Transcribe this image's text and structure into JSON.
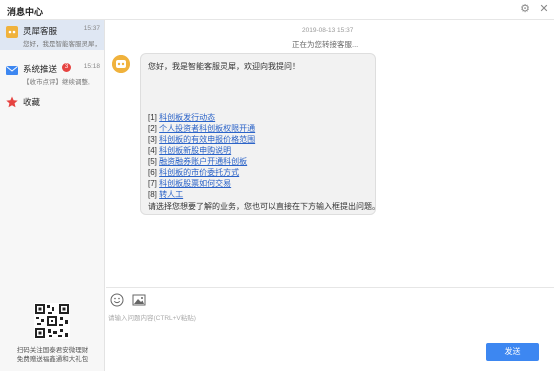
{
  "window": {
    "title": "消息中心",
    "settings_icon": "gear-icon",
    "close_icon": "close-icon"
  },
  "sidebar": {
    "items": [
      {
        "name": "灵犀客服",
        "time": "15:37",
        "preview": "您好，我是智能客服灵犀，欢迎向我提问！",
        "icon": "robot-icon"
      },
      {
        "name": "系统推送",
        "time": "15:18",
        "preview": "【收市点评】继续调整,",
        "badge": "3",
        "icon": "mail-icon"
      },
      {
        "name": "收藏",
        "icon": "star-icon"
      }
    ],
    "qr_text": "扫码关注国泰君安微理财\n免费赠送福鑫通和大礼包"
  },
  "chat": {
    "timestamp": "2019-08-13 15:37",
    "system_message": "正在为您转接客服...",
    "greeting": "您好，我是智能客服灵犀，欢迎向我提问！",
    "options": [
      {
        "num": "[1]",
        "label": "科创板发行动态"
      },
      {
        "num": "[2]",
        "label": "个人投资者科创板权限开通"
      },
      {
        "num": "[3]",
        "label": "科创板的有效申报价格范围"
      },
      {
        "num": "[4]",
        "label": "科创板新股申购说明"
      },
      {
        "num": "[5]",
        "label": "融资融券账户开通科创板"
      },
      {
        "num": "[6]",
        "label": "科创板的市价委托方式"
      },
      {
        "num": "[7]",
        "label": "科创板股票如何交易"
      },
      {
        "num": "[8]",
        "label": "转人工"
      }
    ],
    "prompt": "请选择您想要了解的业务，您也可以直接在下方输入框提出问题。"
  },
  "composer": {
    "placeholder": "请输入问题内容(CTRL+V粘贴)",
    "send_label": "发送",
    "emoji_icon": "emoji-icon",
    "image_icon": "image-icon"
  },
  "colors": {
    "accent": "#3d87f1",
    "link": "#2b63c8",
    "badge": "#e64340",
    "selected_bg": "#dfe7f3"
  }
}
